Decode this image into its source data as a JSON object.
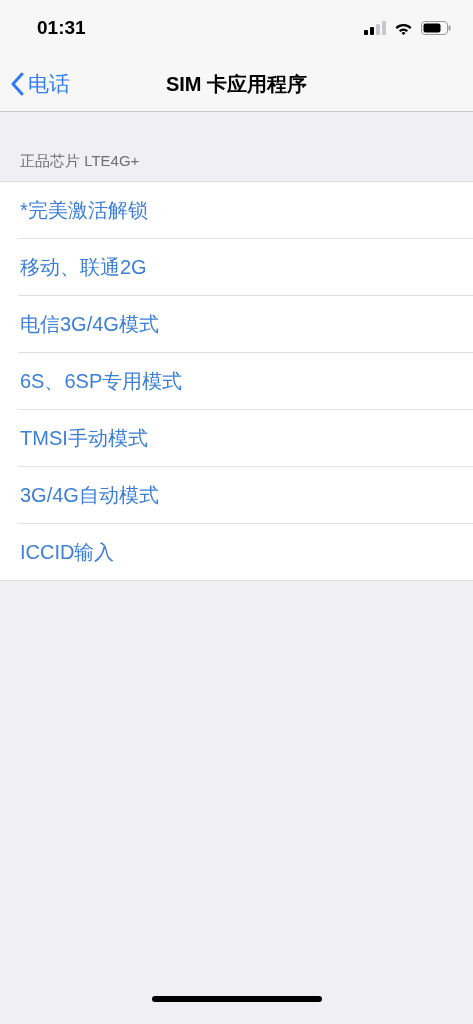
{
  "status_bar": {
    "time": "01:31"
  },
  "nav_bar": {
    "back": "电话",
    "title": "SIM 卡应用程序"
  },
  "section": {
    "header": "正品芯片 LTE4G+",
    "items": [
      "*完美激活解锁",
      "移动、联通2G",
      "电信3G/4G模式",
      "6S、6SP专用模式",
      "TMSI手动模式",
      "3G/4G自动模式",
      "ICCID输入"
    ]
  }
}
